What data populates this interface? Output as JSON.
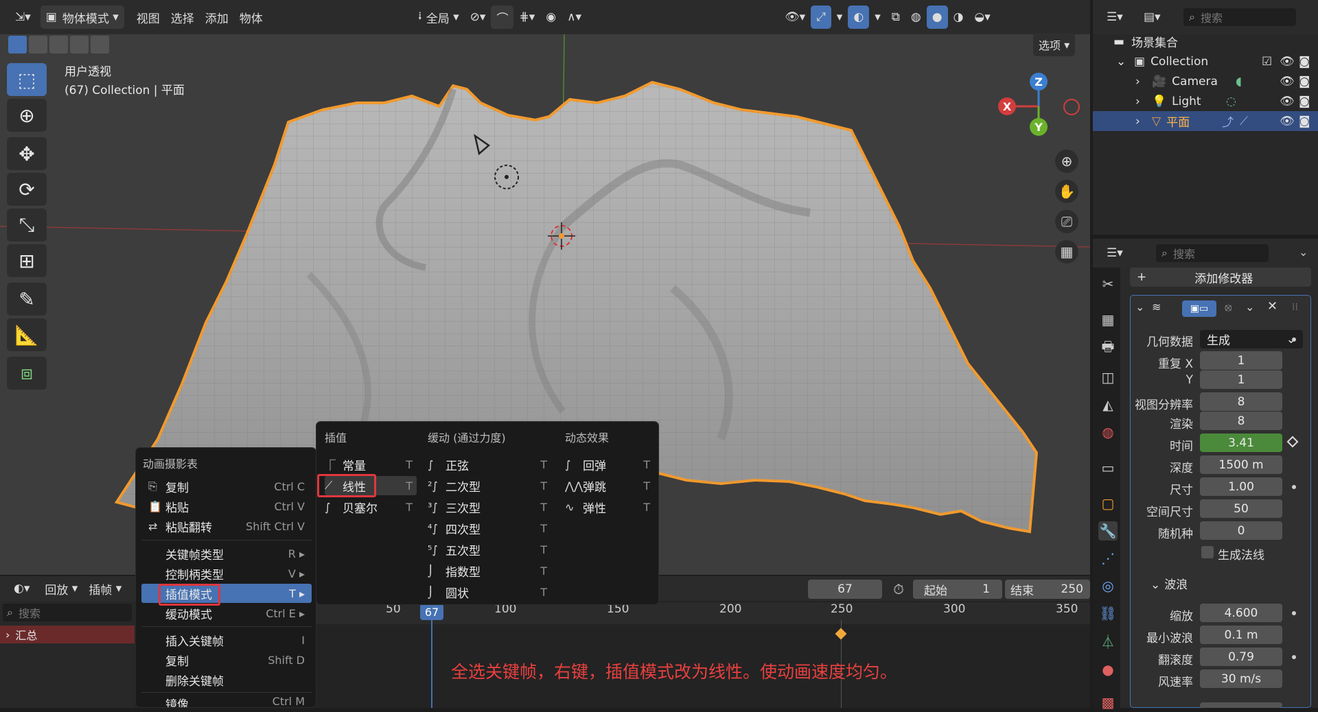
{
  "header": {
    "editor_icon": "editor-type-icon",
    "mode": "物体模式",
    "menus": [
      "视图",
      "选择",
      "添加",
      "物体"
    ],
    "transform_orientation": "全局",
    "options": "选项"
  },
  "viewport": {
    "view_name": "用户透视",
    "object_info": "(67) Collection | 平面",
    "gizmo_axes": [
      "Z",
      "X",
      "Y"
    ]
  },
  "outliner": {
    "search_placeholder": "搜索",
    "scene_collection": "场景集合",
    "rows": [
      {
        "label": "Collection"
      },
      {
        "label": "Camera"
      },
      {
        "label": "Light"
      },
      {
        "label": "平面"
      }
    ]
  },
  "properties": {
    "search_placeholder": "搜索",
    "add_modifier": "添加修改器",
    "geometry_label": "几何数据",
    "geometry_value": "生成",
    "repeat_x_label": "重复 X",
    "repeat_x": "1",
    "repeat_y_label": "Y",
    "repeat_y": "1",
    "viewport_res_label": "视图分辨率",
    "viewport_res": "8",
    "render_label": "渲染",
    "render_res": "8",
    "time_label": "时间",
    "time_value": "3.41",
    "depth_label": "深度",
    "depth_value": "1500 m",
    "size_label": "尺寸",
    "size_value": "1.00",
    "spatial_size_label": "空间尺寸",
    "spatial_size": "50",
    "seed_label": "随机种",
    "seed": "0",
    "normals_label": "生成法线",
    "waves_label": "波浪",
    "scale_label": "缩放",
    "scale_value": "4.600",
    "min_wave_label": "最小波浪",
    "min_wave": "0.1 m",
    "choppiness_label": "翻滚度",
    "choppiness": "0.79",
    "wind_label": "风速率",
    "wind": "30 m/s"
  },
  "timeline": {
    "playback": "回放",
    "keying": "插帧",
    "current_frame": "67",
    "start_label": "起始",
    "start": "1",
    "end_label": "结束",
    "end": "250",
    "ticks": [
      "50",
      "100",
      "150",
      "200",
      "250",
      "300",
      "350"
    ],
    "search_placeholder": "搜索",
    "summary": "汇总",
    "annotation": "全选关键帧，右键，插值模式改为线性。使动画速度均匀。"
  },
  "menu_main": {
    "title": "动画摄影表",
    "items": [
      {
        "label": "复制",
        "shortcut": "Ctrl C",
        "icon": "copy-icon"
      },
      {
        "label": "粘贴",
        "shortcut": "Ctrl V",
        "icon": "paste-icon"
      },
      {
        "label": "粘贴翻转",
        "shortcut": "Shift Ctrl V",
        "icon": "paste-flip-icon"
      },
      {
        "label": "关键帧类型",
        "shortcut": "R"
      },
      {
        "label": "控制柄类型",
        "shortcut": "V"
      },
      {
        "label": "插值模式",
        "shortcut": "T"
      },
      {
        "label": "缓动模式",
        "shortcut": "Ctrl E"
      },
      {
        "label": "插入关键帧",
        "shortcut": "I"
      },
      {
        "label": "复制",
        "shortcut": "Shift D"
      },
      {
        "label": "删除关键帧",
        "shortcut": ""
      },
      {
        "label": "镜像",
        "shortcut": "Ctrl M"
      }
    ]
  },
  "menu_sub": {
    "col1_title": "插值",
    "col1": [
      {
        "label": "常量",
        "shortcut": "T"
      },
      {
        "label": "线性",
        "shortcut": "T"
      },
      {
        "label": "贝塞尔",
        "shortcut": "T"
      }
    ],
    "col2_title": "缓动 (通过力度)",
    "col2": [
      {
        "label": "正弦",
        "shortcut": "T"
      },
      {
        "label": "二次型",
        "shortcut": "T"
      },
      {
        "label": "三次型",
        "shortcut": "T"
      },
      {
        "label": "四次型",
        "shortcut": "T"
      },
      {
        "label": "五次型",
        "shortcut": "T"
      },
      {
        "label": "指数型",
        "shortcut": "T"
      },
      {
        "label": "圆状",
        "shortcut": "T"
      }
    ],
    "col3_title": "动态效果",
    "col3": [
      {
        "label": "回弹",
        "shortcut": "T"
      },
      {
        "label": "弹跳",
        "shortcut": "T"
      },
      {
        "label": "弹性",
        "shortcut": "T"
      }
    ]
  },
  "colors": {
    "accent": "#4772b3",
    "outline": "#f29a2e",
    "highlight_box": "#e0363e",
    "annotation": "#e8403f",
    "time_field": "#4b8a3a"
  }
}
